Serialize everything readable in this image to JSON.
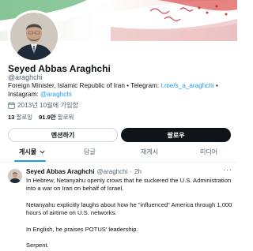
{
  "profile": {
    "name": "Seyed Abbas Araghchi",
    "handle": "@araghchi",
    "bio_text": "Foreign Minister, Islamic Republic of Iran • Telegram: ",
    "bio_link1": "t.me/s_a_araghchi",
    "bio_mid": " • Instagram: ",
    "bio_link2": "@araghchi",
    "joined": "2013년 10월에 가입함",
    "following_count": "13",
    "following_label": "팔로잉",
    "followers_count": "91.9만",
    "followers_label": "팔로워"
  },
  "buttons": {
    "mention_label": "멘션하기",
    "follow_label": "팔로우"
  },
  "tabs": [
    {
      "label": "게시물"
    },
    {
      "label": "답글"
    },
    {
      "label": "재게시"
    },
    {
      "label": "미디어"
    }
  ],
  "post": {
    "author": "Seyed Abbas Araghchi",
    "handle": "@araghchi",
    "separator": "·",
    "time": "2h",
    "more": "···",
    "paragraphs": [
      "In Hebrew, Netanyahu openly crows that he suckered the U.S. Administration into a war on Iran on behalf of Israel.",
      "Netanyahu explicitly laughs about how he \"influenced\" America through 1,000 hours of airtime on U.S. networks.",
      "In English, he praises POTUS' leadership.",
      "Serpent."
    ]
  },
  "icons": {
    "calendar": "calendar-icon",
    "chevron": "chevron-down-icon",
    "more": "more-icon"
  },
  "colors": {
    "accent": "#1d9bf0",
    "follow_button": "#0f1419",
    "muted_text": "#536471",
    "flag_green": "#239f40",
    "flag_red": "#da0000"
  }
}
